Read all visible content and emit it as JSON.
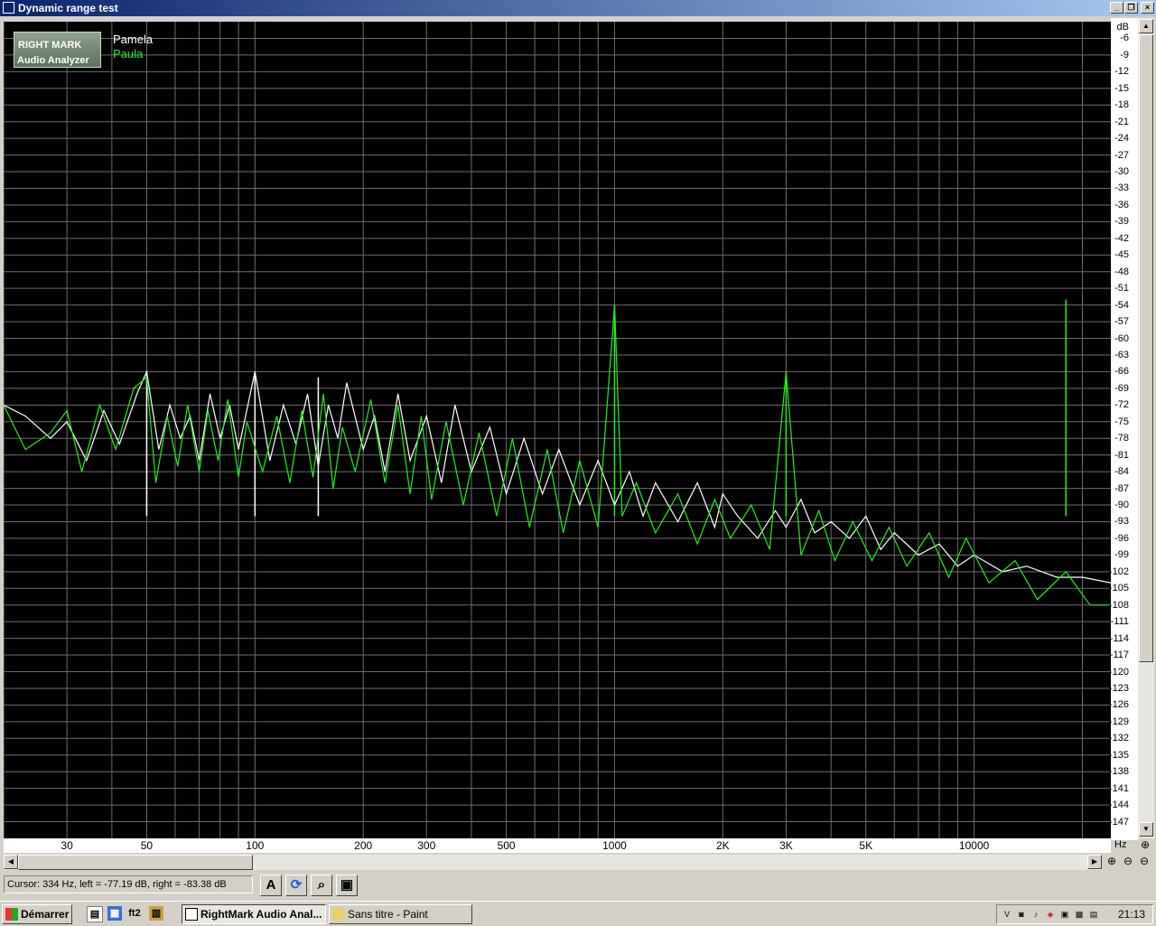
{
  "window": {
    "title": "Dynamic range test",
    "min": "_",
    "restore": "❐",
    "close": "×"
  },
  "logo": {
    "line1": "RIGHT MARK",
    "line2": "Audio Analyzer"
  },
  "legend": [
    {
      "name": "Pamela",
      "color": "#ffffff"
    },
    {
      "name": "Paula",
      "color": "#22ee22"
    }
  ],
  "status": {
    "cursor": "Cursor:  334 Hz,  left = -77.19 dB,  right = -83.38 dB"
  },
  "toolbar": {
    "font_icon": "A"
  },
  "axis": {
    "x_unit": "Hz",
    "y_unit": "dB"
  },
  "taskbar": {
    "start": "Démarrer",
    "quick": [
      "ft2"
    ],
    "tasks": [
      "RightMark Audio Anal...",
      "Sans titre - Paint"
    ],
    "clock": "21:13"
  },
  "chart_data": {
    "type": "line",
    "xscale": "log",
    "xlim": [
      20,
      24000
    ],
    "ylim": [
      -150,
      -3
    ],
    "xticks": [
      30,
      50,
      100,
      200,
      300,
      500,
      1000,
      2000,
      3000,
      5000,
      10000
    ],
    "xtick_labels": [
      "30",
      "50",
      "100",
      "200",
      "300",
      "500",
      "1000",
      "2K",
      "3K",
      "5K",
      "10000"
    ],
    "yticks": [
      -6,
      -9,
      -12,
      -15,
      -18,
      -21,
      -24,
      -27,
      -30,
      -33,
      -36,
      -39,
      -42,
      -45,
      -48,
      -51,
      -54,
      -57,
      -60,
      -63,
      -66,
      -69,
      -72,
      -75,
      -78,
      -81,
      -84,
      -87,
      -90,
      -93,
      -96,
      -99,
      -102,
      -105,
      -108,
      -111,
      -114,
      -117,
      -120,
      -123,
      -126,
      -129,
      -132,
      -135,
      -138,
      -141,
      -144,
      -147
    ],
    "series": [
      {
        "name": "Pamela",
        "color": "#ffffff",
        "x": [
          20,
          23,
          27,
          30,
          34,
          38,
          42,
          47,
          50,
          54,
          58,
          62,
          66,
          70,
          75,
          80,
          85,
          90,
          100,
          110,
          120,
          130,
          140,
          150,
          160,
          170,
          180,
          200,
          215,
          230,
          250,
          270,
          300,
          330,
          360,
          400,
          450,
          500,
          560,
          630,
          700,
          800,
          900,
          1000,
          1100,
          1200,
          1300,
          1500,
          1700,
          1900,
          2000,
          2200,
          2500,
          2800,
          3000,
          3300,
          3600,
          4000,
          4500,
          5000,
          5500,
          6000,
          7000,
          8000,
          9000,
          10000,
          12000,
          14000,
          17000,
          20000,
          24000
        ],
        "y": [
          -72,
          -74,
          -78,
          -75,
          -82,
          -73,
          -79,
          -70,
          -66,
          -80,
          -72,
          -78,
          -74,
          -82,
          -70,
          -78,
          -72,
          -80,
          -66,
          -82,
          -72,
          -79,
          -70,
          -83,
          -72,
          -78,
          -68,
          -80,
          -74,
          -84,
          -70,
          -82,
          -74,
          -86,
          -72,
          -84,
          -76,
          -88,
          -78,
          -88,
          -80,
          -90,
          -82,
          -90,
          -84,
          -92,
          -86,
          -93,
          -86,
          -94,
          -88,
          -92,
          -96,
          -91,
          -94,
          -89,
          -95,
          -93,
          -96,
          -92,
          -98,
          -95,
          -99,
          -97,
          -101,
          -99,
          -102,
          -101,
          -103,
          -103,
          -104
        ]
      },
      {
        "name": "Paula",
        "color": "#22ee22",
        "x": [
          20,
          23,
          27,
          30,
          33,
          37,
          41,
          46,
          50,
          53,
          57,
          61,
          65,
          70,
          74,
          79,
          84,
          90,
          95,
          105,
          115,
          125,
          135,
          145,
          155,
          165,
          175,
          190,
          210,
          230,
          250,
          270,
          290,
          310,
          340,
          380,
          420,
          470,
          520,
          580,
          650,
          720,
          800,
          900,
          1000,
          1050,
          1150,
          1300,
          1500,
          1700,
          1900,
          2100,
          2400,
          2700,
          3000,
          3300,
          3700,
          4100,
          4600,
          5200,
          5800,
          6500,
          7500,
          8500,
          9500,
          11000,
          13000,
          15000,
          18000,
          21000,
          24000
        ],
        "y": [
          -72,
          -80,
          -77,
          -73,
          -84,
          -72,
          -80,
          -69,
          -67,
          -86,
          -74,
          -83,
          -72,
          -84,
          -73,
          -82,
          -71,
          -85,
          -75,
          -84,
          -74,
          -86,
          -73,
          -85,
          -70,
          -87,
          -76,
          -84,
          -71,
          -86,
          -72,
          -88,
          -74,
          -89,
          -75,
          -90,
          -77,
          -92,
          -78,
          -94,
          -80,
          -95,
          -82,
          -94,
          -54,
          -92,
          -86,
          -95,
          -88,
          -97,
          -89,
          -96,
          -90,
          -98,
          -66,
          -99,
          -91,
          -100,
          -93,
          -100,
          -94,
          -101,
          -95,
          -103,
          -96,
          -104,
          -100,
          -107,
          -102,
          -108,
          -108
        ]
      }
    ],
    "peaks": [
      {
        "series": "Paula",
        "x": 1000,
        "y": -54
      },
      {
        "series": "Paula",
        "x": 3000,
        "y": -66
      },
      {
        "series": "Paula",
        "x": 18000,
        "y": -53
      },
      {
        "series": "Pamela",
        "x": 100,
        "y": -66
      },
      {
        "series": "Pamela",
        "x": 150,
        "y": -67
      },
      {
        "series": "Pamela",
        "x": 50,
        "y": -66
      }
    ]
  }
}
